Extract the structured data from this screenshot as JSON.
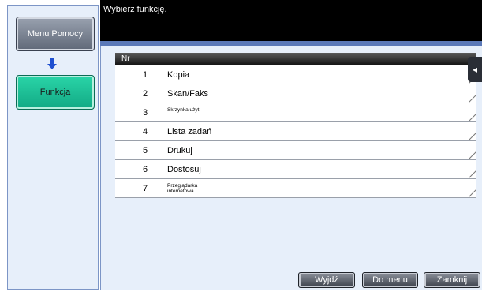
{
  "message": "Wybierz funkcję.",
  "sidebar": {
    "help_menu_label": "Menu Pomocy",
    "function_label": "Funkcja"
  },
  "list": {
    "header": "Nr",
    "rows": [
      {
        "num": "1",
        "label": "Kopia"
      },
      {
        "num": "2",
        "label": "Skan/Faks"
      },
      {
        "num": "3",
        "label": "Skrzynka użyt."
      },
      {
        "num": "4",
        "label": "Lista zadań"
      },
      {
        "num": "5",
        "label": "Drukuj"
      },
      {
        "num": "6",
        "label": "Dostosuj"
      },
      {
        "num": "7",
        "label": "Przeglądarka internetowa"
      }
    ]
  },
  "side_tab_glyph": "◂",
  "buttons": {
    "exit": "Wyjdź",
    "to_menu": "Do menu",
    "close": "Zamknij"
  },
  "colors": {
    "function_active": "#1bbf95",
    "accent_blue": "#5b79b8",
    "panel_bg": "#e7effa"
  }
}
